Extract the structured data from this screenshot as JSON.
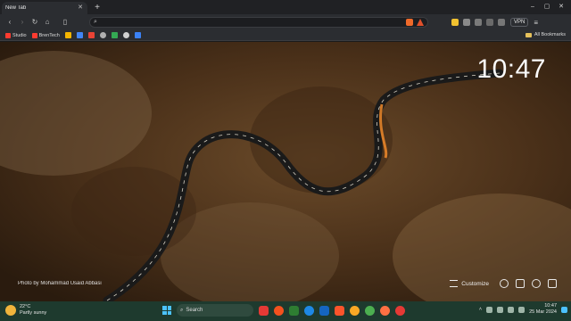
{
  "tab": {
    "title": "New Tab"
  },
  "toolbar": {
    "search_value": "",
    "vpn_label": "VPN"
  },
  "bookmarks": {
    "items": [
      {
        "label": "Studio",
        "color": "#ff3b30"
      },
      {
        "label": "BrenTech",
        "color": "#ff3b30"
      }
    ],
    "all_label": "All Bookmarks"
  },
  "content": {
    "clock": "10:47",
    "credit": "Photo by Mohammad Usaid Abbasi",
    "customize_label": "Customize"
  },
  "taskbar": {
    "weather_temp": "22°C",
    "weather_desc": "Partly sunny",
    "search_label": "Search",
    "time": "10:47",
    "date": "25 Mar 2024"
  }
}
